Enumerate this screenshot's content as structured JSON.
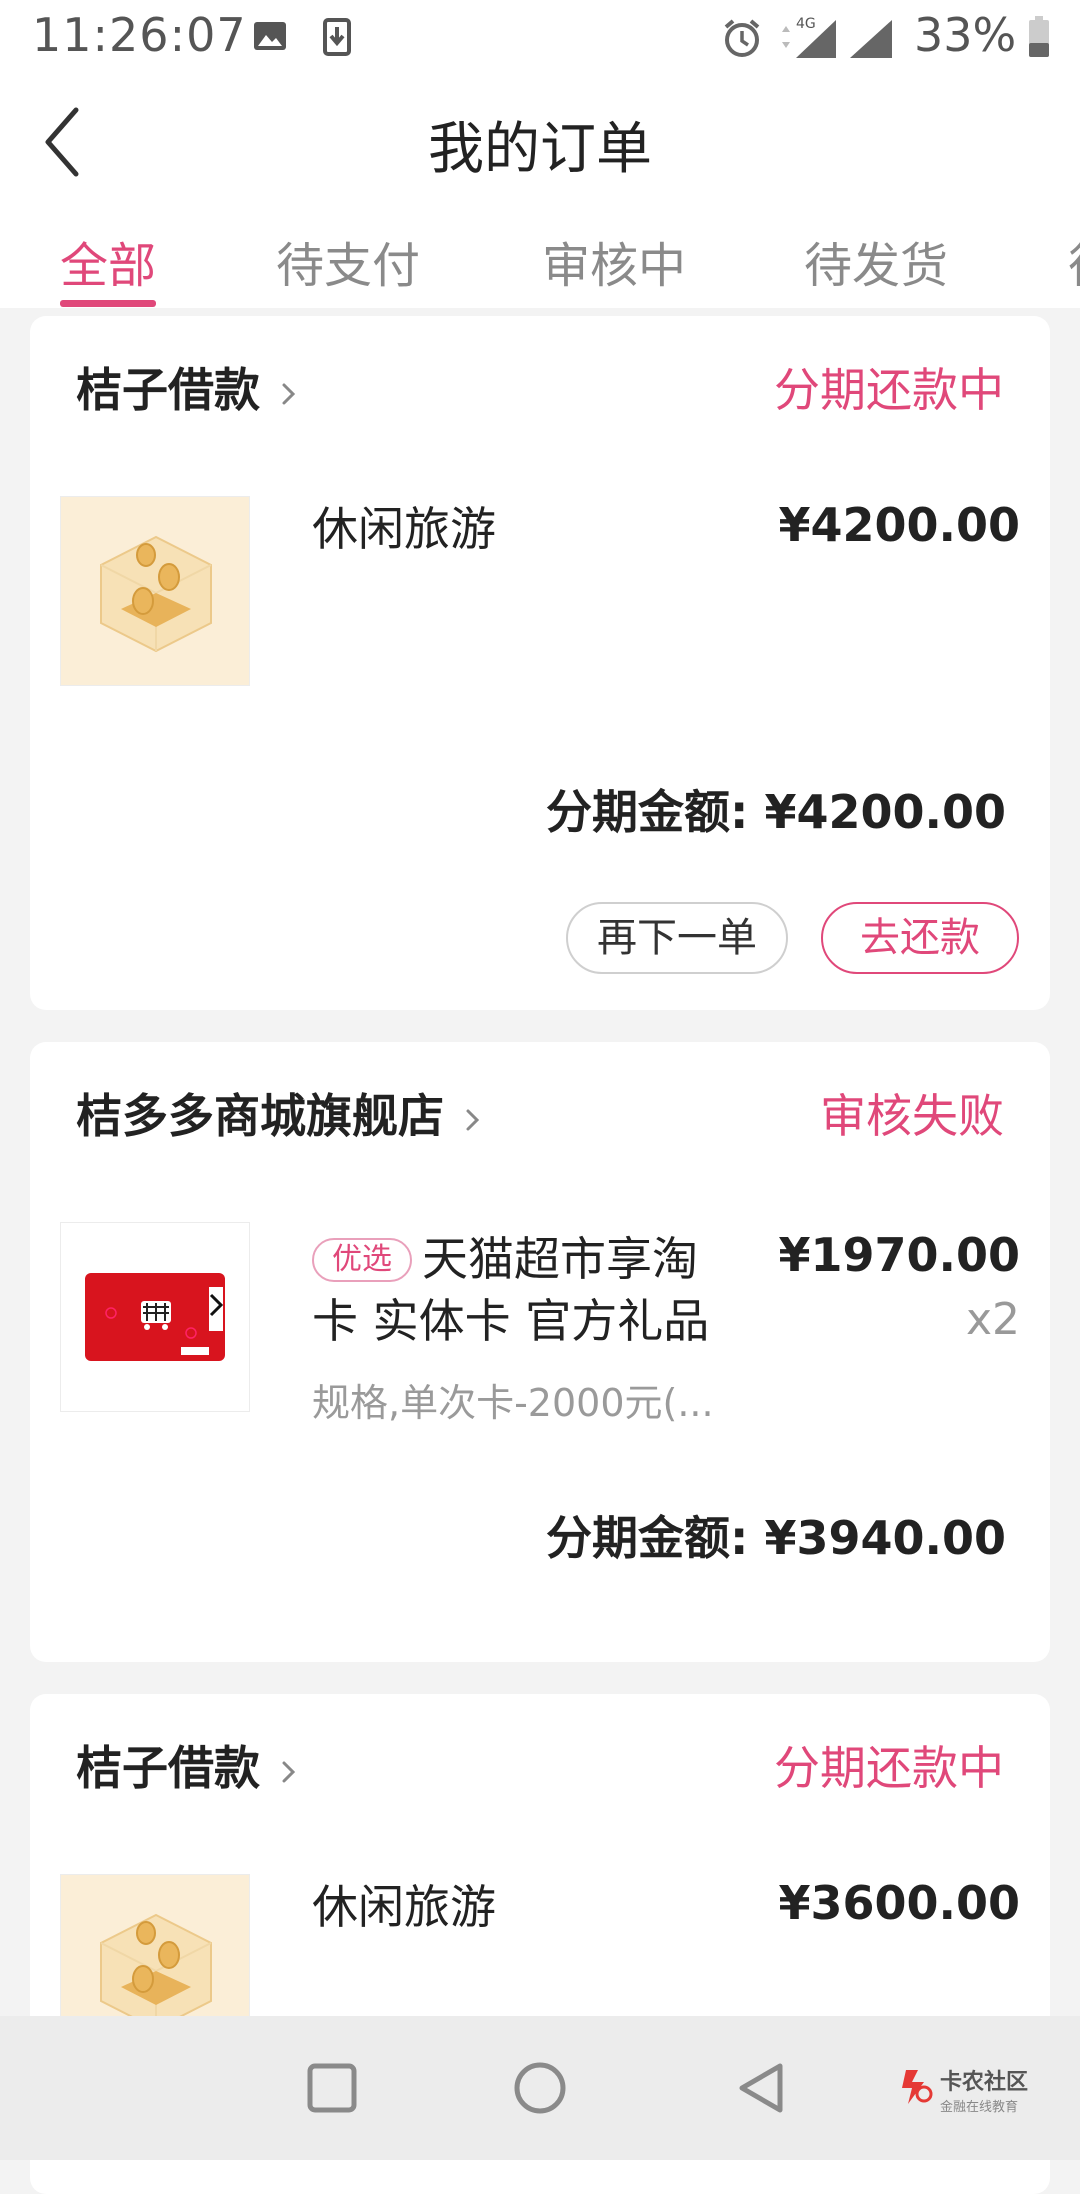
{
  "status_bar": {
    "time": "11:26:07",
    "network": "4G",
    "battery": "33%",
    "icons": [
      "image-icon",
      "download-icon",
      "alarm-icon",
      "signal-icon",
      "battery-icon"
    ]
  },
  "header": {
    "title": "我的订单",
    "back_icon": "chevron-left-icon"
  },
  "tabs": [
    {
      "label": "全部",
      "active": true
    },
    {
      "label": "待支付",
      "active": false
    },
    {
      "label": "审核中",
      "active": false
    },
    {
      "label": "待发货",
      "active": false
    },
    {
      "label": "待",
      "active": false
    }
  ],
  "orders": [
    {
      "store": "桔子借款",
      "status": "分期还款中",
      "product": {
        "name": "休闲旅游",
        "price": "¥4200.00",
        "image": "coin-cube"
      },
      "installment_label": "分期金额:",
      "installment_amount": "¥4200.00",
      "buttons": {
        "reorder": "再下一单",
        "repay": "去还款"
      }
    },
    {
      "store": "桔多多商城旗舰店",
      "status": "审核失败",
      "product": {
        "tag": "优选",
        "name_line1": "天猫超市享淘",
        "name_line2": "卡 实体卡 官方礼品",
        "price": "¥1970.00",
        "qty": "x2",
        "spec": "规格,单次卡-2000元(...",
        "image": "tmall-gift-card"
      },
      "installment_label": "分期金额:",
      "installment_amount": "¥3940.00"
    },
    {
      "store": "桔子借款",
      "status": "分期还款中",
      "product": {
        "name": "休闲旅游",
        "price": "¥3600.00",
        "image": "coin-cube"
      }
    }
  ],
  "nav_bar": {
    "icons": [
      "recents-square-icon",
      "home-circle-icon",
      "back-triangle-icon"
    ],
    "watermark_title": "卡农社区",
    "watermark_sub": "金融在线教育"
  },
  "colors": {
    "accent": "#e0487a",
    "background": "#f3f3f3",
    "card": "#ffffff"
  }
}
